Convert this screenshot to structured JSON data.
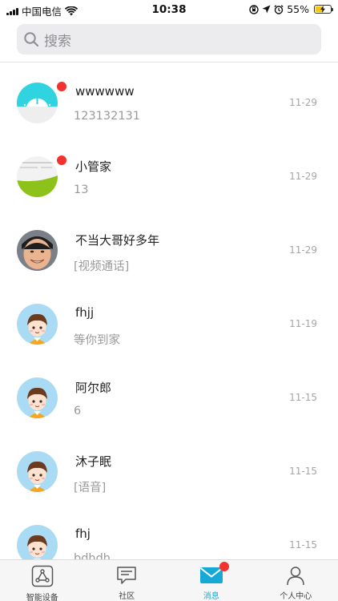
{
  "status_bar": {
    "carrier": "中国电信",
    "time": "10:38",
    "battery": "55%",
    "battery_level": 0.55
  },
  "search": {
    "placeholder": "搜索"
  },
  "messages": [
    {
      "name": "wwwwww",
      "preview": "123132131",
      "date": "11-29",
      "unread": true,
      "avatar": "scale-icon"
    },
    {
      "name": "小管家",
      "preview": "13",
      "date": "11-29",
      "unread": true,
      "avatar": "green-photo"
    },
    {
      "name": "不当大哥好多年",
      "preview": "[视频通话]",
      "date": "11-29",
      "unread": false,
      "avatar": "person-photo"
    },
    {
      "name": "fhjj",
      "preview": "等你到家",
      "date": "11-19",
      "unread": false,
      "avatar": "cartoon-boy"
    },
    {
      "name": "阿尔郎",
      "preview": "6",
      "date": "11-15",
      "unread": false,
      "avatar": "cartoon-boy"
    },
    {
      "name": "沐子眠",
      "preview": "[语音]",
      "date": "11-15",
      "unread": false,
      "avatar": "cartoon-boy"
    },
    {
      "name": "fhj",
      "preview": "bdhdh",
      "date": "11-15",
      "unread": false,
      "avatar": "cartoon-boy"
    }
  ],
  "tabs": [
    {
      "label": "智能设备",
      "icon": "share-nodes-icon",
      "active": false
    },
    {
      "label": "社区",
      "icon": "chat-bubble-icon",
      "active": false
    },
    {
      "label": "消息",
      "icon": "envelope-icon",
      "active": true,
      "badge": true
    },
    {
      "label": "个人中心",
      "icon": "person-icon",
      "active": false
    }
  ],
  "colors": {
    "accent": "#17a9d6",
    "badge": "#f2322f",
    "scale_avatar": "#2fd4e0",
    "green_avatar": "#8cc21a",
    "cartoon_bg": "#a9dcf4"
  }
}
